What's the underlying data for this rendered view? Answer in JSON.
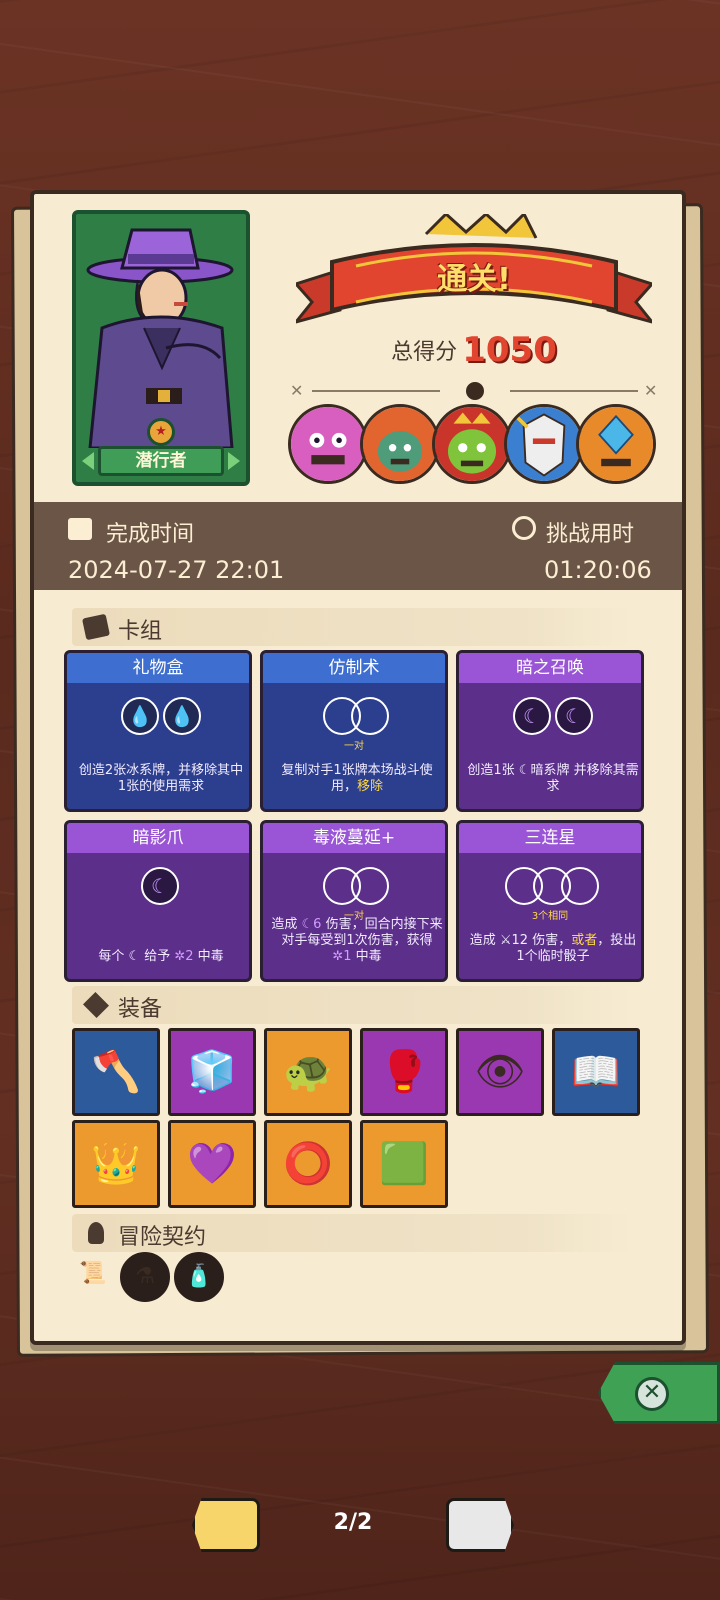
{
  "character": {
    "name": "潜行者",
    "medal_icon": "medal-icon"
  },
  "result": {
    "banner": "通关!",
    "score_label": "总得分",
    "score_value": "1050"
  },
  "bosses": [
    "boss-purple-demon",
    "boss-red-hair-ogre",
    "boss-green-goblin-king",
    "boss-white-knight",
    "boss-crystal-golem"
  ],
  "time": {
    "finish_label": "完成时间",
    "finish_value": "2024-07-27 22:01",
    "duration_label": "挑战用时",
    "duration_value": "01:20:06"
  },
  "sections": {
    "deck": "卡组",
    "equipment": "装备",
    "contracts": "冒险契约"
  },
  "cards": [
    {
      "title": "礼物盒",
      "type": "blue",
      "orbs": [
        "water",
        "water"
      ],
      "sub": "",
      "desc_parts": [
        "创造2张冰系牌，并移除其中1张的使用需求"
      ]
    },
    {
      "title": "仿制术",
      "type": "blue",
      "orbs": [
        "empty",
        "empty"
      ],
      "sub": "一对",
      "desc_a": "复制对手1张牌本场战斗使用，",
      "desc_b": "移除"
    },
    {
      "title": "暗之召唤",
      "type": "purple",
      "orbs": [
        "moon",
        "moon"
      ],
      "sub": "",
      "desc_parts": [
        "创造1张 ☾暗系牌 并移除其需求"
      ]
    },
    {
      "title": "暗影爪",
      "type": "purple",
      "orbs": [
        "moon"
      ],
      "sub": "",
      "desc_a": "每个 ☾ 给予 ",
      "desc_b": "✲2",
      "desc_c": " 中毒"
    },
    {
      "title": "毒液蔓延+",
      "type": "purple",
      "orbs": [
        "empty",
        "empty"
      ],
      "sub": "一对",
      "desc_a": "造成 ",
      "desc_b": "☾6",
      "desc_c": " 伤害，回合内接下来对手每受到1次伤害，获得 ",
      "desc_d": "✲1",
      "desc_e": " 中毒"
    },
    {
      "title": "三连星",
      "type": "purple",
      "orbs": [
        "empty",
        "empty",
        "empty"
      ],
      "sub": "3个相同",
      "desc_a": "造成 ⚔12 伤害，",
      "desc_b": "或者",
      "desc_c": "，投出1个临时骰子"
    }
  ],
  "equipment": [
    {
      "name": "axe",
      "color": "blue",
      "icon": "🪓"
    },
    {
      "name": "iron-cube",
      "color": "purple",
      "icon": "🧊"
    },
    {
      "name": "turtle-shell",
      "color": "orange",
      "icon": "🐢"
    },
    {
      "name": "red-gauntlet",
      "color": "purple",
      "icon": "🥊"
    },
    {
      "name": "eye-ring",
      "color": "purple",
      "icon": "👁"
    },
    {
      "name": "skull-book",
      "color": "blue",
      "icon": "📖"
    },
    {
      "name": "golden-crown",
      "color": "orange",
      "icon": "👑"
    },
    {
      "name": "thorn-heart",
      "color": "orange",
      "icon": "💜"
    },
    {
      "name": "spiked-bracelet",
      "color": "orange",
      "icon": "⭕"
    },
    {
      "name": "moss-stone",
      "color": "orange",
      "icon": "🟩"
    }
  ],
  "contracts": [
    {
      "name": "scroll",
      "icon": "📜"
    },
    {
      "name": "potion-bottle",
      "icon": "⚗"
    },
    {
      "name": "jar",
      "icon": "🧴"
    }
  ],
  "pager": {
    "indicator": "2/2"
  },
  "colors": {
    "wood": "#5b2a1f",
    "paper": "#f7ecd2",
    "score": "#e2452f",
    "blue_card": "#2c3f8f",
    "purple_card": "#5b2f8a",
    "close": "#3ea154"
  }
}
